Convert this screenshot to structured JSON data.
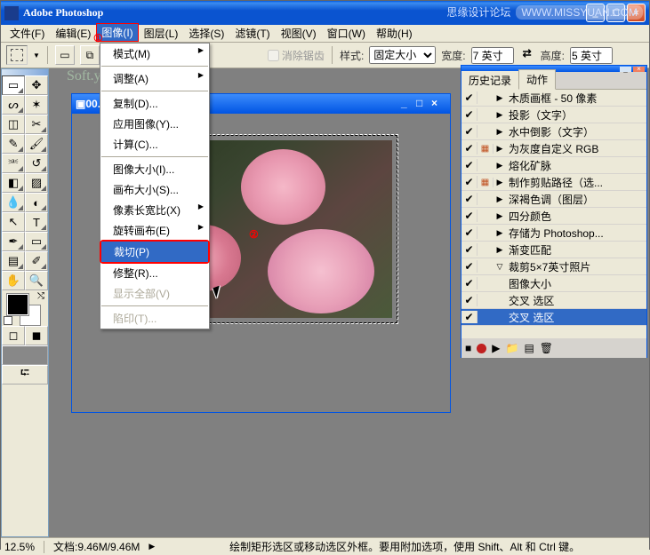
{
  "title": "Adobe Photoshop",
  "watermark": {
    "a": "思缘设计论坛",
    "b": "WWW.MISSYUAN.COM"
  },
  "menu": {
    "file": "文件(F)",
    "edit": "编辑(E)",
    "image": "图像(I)",
    "layer": "图层(L)",
    "select": "选择(S)",
    "filter": "滤镜(T)",
    "view": "视图(V)",
    "window": "窗口(W)",
    "help": "帮助(H)"
  },
  "labels": {
    "num1": "①",
    "num2": "②"
  },
  "dropdown": {
    "mode": "模式(M)",
    "adjust": "调整(A)",
    "duplicate": "复制(D)...",
    "apply_image": "应用图像(Y)...",
    "calc": "计算(C)...",
    "image_size": "图像大小(I)...",
    "canvas_size": "画布大小(S)...",
    "pixel_ratio": "像素长宽比(X)",
    "rotate": "旋转画布(E)",
    "crop": "裁切(P)",
    "trim": "修整(R)...",
    "reveal": "显示全部(V)",
    "trap": "陷印(T)..."
  },
  "optbar": {
    "antialias": "消除锯齿",
    "style": "样式:",
    "style_val": "固定大小",
    "width": "宽度:",
    "width_val": "7 英寸",
    "height": "高度:",
    "height_val": "5 英寸"
  },
  "doc": {
    "title": "00... (RGB/8)"
  },
  "ylink": "Soft.yesky.com",
  "hist": {
    "tab1": "历史记录",
    "tab2": "动作",
    "items": [
      {
        "c2": "",
        "c3": "▶",
        "t": "木质画框 - 50 像素",
        "ind": 0
      },
      {
        "c2": "",
        "c3": "▶",
        "t": "投影（文字）",
        "ind": 0
      },
      {
        "c2": "",
        "c3": "▶",
        "t": "水中倒影（文字）",
        "ind": 0
      },
      {
        "c2": "▦",
        "c3": "▶",
        "t": "为灰度自定义 RGB",
        "ind": 0,
        "c2c": "#c05020"
      },
      {
        "c2": "",
        "c3": "▶",
        "t": "熔化矿脉",
        "ind": 0
      },
      {
        "c2": "▦",
        "c3": "▶",
        "t": "制作剪贴路径（选...",
        "ind": 0,
        "c2c": "#c05020"
      },
      {
        "c2": "",
        "c3": "▶",
        "t": "深褐色调（图层）",
        "ind": 0
      },
      {
        "c2": "",
        "c3": "▶",
        "t": "四分颜色",
        "ind": 0
      },
      {
        "c2": "",
        "c3": "▶",
        "t": "存储为 Photoshop...",
        "ind": 0
      },
      {
        "c2": "",
        "c3": "▶",
        "t": "渐变匹配",
        "ind": 0
      },
      {
        "c2": "",
        "c3": "▽",
        "t": "裁剪5×7英寸照片",
        "ind": 0
      },
      {
        "c2": "",
        "c3": "",
        "t": "图像大小",
        "ind": 1
      },
      {
        "c2": "",
        "c3": "",
        "t": "交叉 选区",
        "ind": 1
      },
      {
        "c2": "",
        "c3": "",
        "t": "交叉 选区",
        "ind": 1,
        "sel": true
      }
    ]
  },
  "status": {
    "zoom": "12.5%",
    "doc": "文档:9.46M/9.46M",
    "hint": "绘制矩形选区或移动选区外框。要用附加选项，使用 Shift、Alt 和 Ctrl 键。"
  }
}
